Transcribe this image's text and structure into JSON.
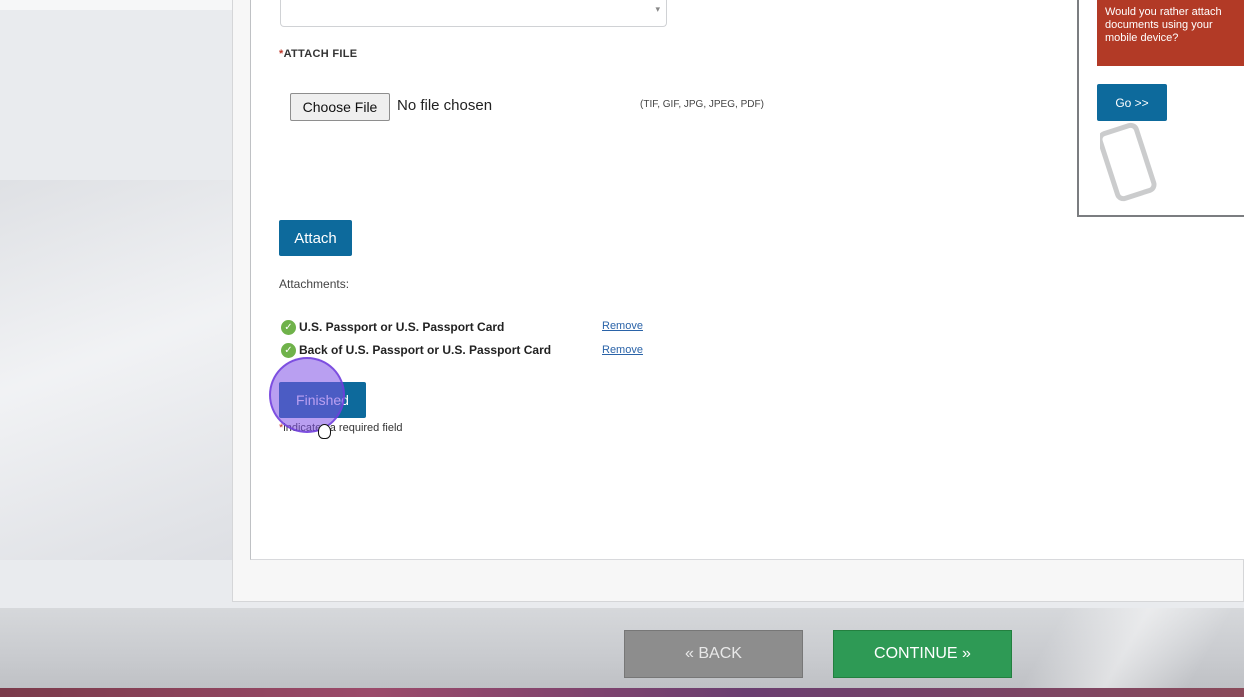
{
  "form": {
    "attach_file_required_mark": "*",
    "attach_file_label": "ATTACH FILE",
    "choose_file_button": "Choose File",
    "no_file_text": "No file chosen",
    "file_types": "(TIF, GIF, JPG, JPEG, PDF)",
    "attach_button": "Attach",
    "attachments_label": "Attachments:",
    "attachments": [
      {
        "name": "U.S. Passport or U.S. Passport Card",
        "remove_label": "Remove"
      },
      {
        "name": "Back of U.S. Passport or U.S. Passport Card",
        "remove_label": "Remove"
      }
    ],
    "finished_button": "Finished",
    "required_mark": "*",
    "required_note": "indicates a required field"
  },
  "side_panel": {
    "prompt_text": "Would you rather attach documents using your mobile device?",
    "go_button": "Go >>",
    "icon": "phone-icon"
  },
  "footer": {
    "back_button": "« BACK",
    "continue_button": "CONTINUE »"
  },
  "colors": {
    "primary_button": "#0d6a9c",
    "continue_green": "#2e9a55",
    "back_gray": "#8d8d8d",
    "panel_red": "#b23a26",
    "success_check": "#6fb24a",
    "link_blue": "#2a63a8"
  }
}
